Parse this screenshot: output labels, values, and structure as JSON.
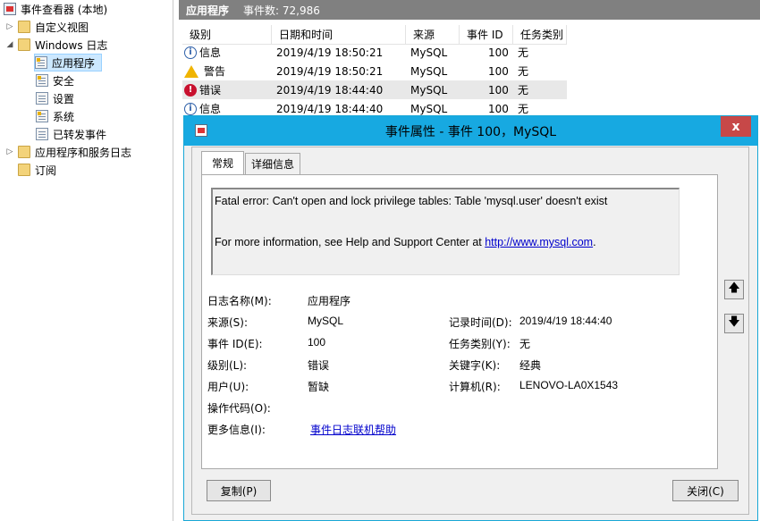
{
  "tree": {
    "root_label": "事件查看器 (本地)",
    "items": [
      {
        "label": "自定义视图",
        "arrow": "▷",
        "icon": "folder-icon"
      },
      {
        "label": "Windows 日志",
        "arrow": "◢",
        "icon": "folder-icon"
      },
      {
        "label": "应用程序",
        "icon": "log-icon"
      },
      {
        "label": "安全",
        "icon": "log-icon"
      },
      {
        "label": "设置",
        "icon": "log-icon"
      },
      {
        "label": "系统",
        "icon": "log-icon"
      },
      {
        "label": "已转发事件",
        "icon": "log-icon"
      },
      {
        "label": "应用程序和服务日志",
        "arrow": "▷",
        "icon": "folder-icon"
      },
      {
        "label": "订阅",
        "icon": "folder-icon"
      }
    ]
  },
  "right_header": {
    "title": "应用程序",
    "count": "事件数: 72,986"
  },
  "event_list": {
    "columns": [
      "级别",
      "日期和时间",
      "来源",
      "事件 ID",
      "任务类别"
    ],
    "rows": [
      {
        "level": "信息",
        "datetime": "2019/4/19 18:50:21",
        "source": "MySQL",
        "id": "100",
        "task": "无"
      },
      {
        "level": "警告",
        "datetime": "2019/4/19 18:50:21",
        "source": "MySQL",
        "id": "100",
        "task": "无"
      },
      {
        "level": "错误",
        "datetime": "2019/4/19 18:44:40",
        "source": "MySQL",
        "id": "100",
        "task": "无"
      },
      {
        "level": "信息",
        "datetime": "2019/4/19 18:44:40",
        "source": "MySQL",
        "id": "100",
        "task": "无"
      }
    ]
  },
  "dialog": {
    "title": "事件属性 - 事件 100，MySQL",
    "close_glyph": "x",
    "tabs": [
      "常规",
      "详细信息"
    ],
    "message_line1": "Fatal error: Can't open and lock privilege tables: Table 'mysql.user' doesn't exist",
    "message_line2_prefix": "For more information, see Help and Support Center at ",
    "message_link": "http://www.mysql.com",
    "message_line2_suffix": ".",
    "props": {
      "log_name_label": "日志名称(M):",
      "log_name_value": "应用程序",
      "source_label": "来源(S):",
      "source_value": "MySQL",
      "logged_label": "记录时间(D):",
      "logged_value": "2019/4/19 18:44:40",
      "event_id_label": "事件 ID(E):",
      "event_id_value": "100",
      "task_label": "任务类别(Y):",
      "task_value": "无",
      "level_label": "级别(L):",
      "level_value": "错误",
      "keywords_label": "关键字(K):",
      "keywords_value": "经典",
      "user_label": "用户(U):",
      "user_value": "暂缺",
      "computer_label": "计算机(R):",
      "computer_value": "LENOVO-LA0X1543",
      "opcode_label": "操作代码(O):",
      "more_info_label": "更多信息(I):",
      "more_info_link": "事件日志联机帮助"
    },
    "copy_button": "复制(P)",
    "close_button": "关闭(C)",
    "up_arrow": "🡅",
    "down_arrow": "🡇"
  }
}
